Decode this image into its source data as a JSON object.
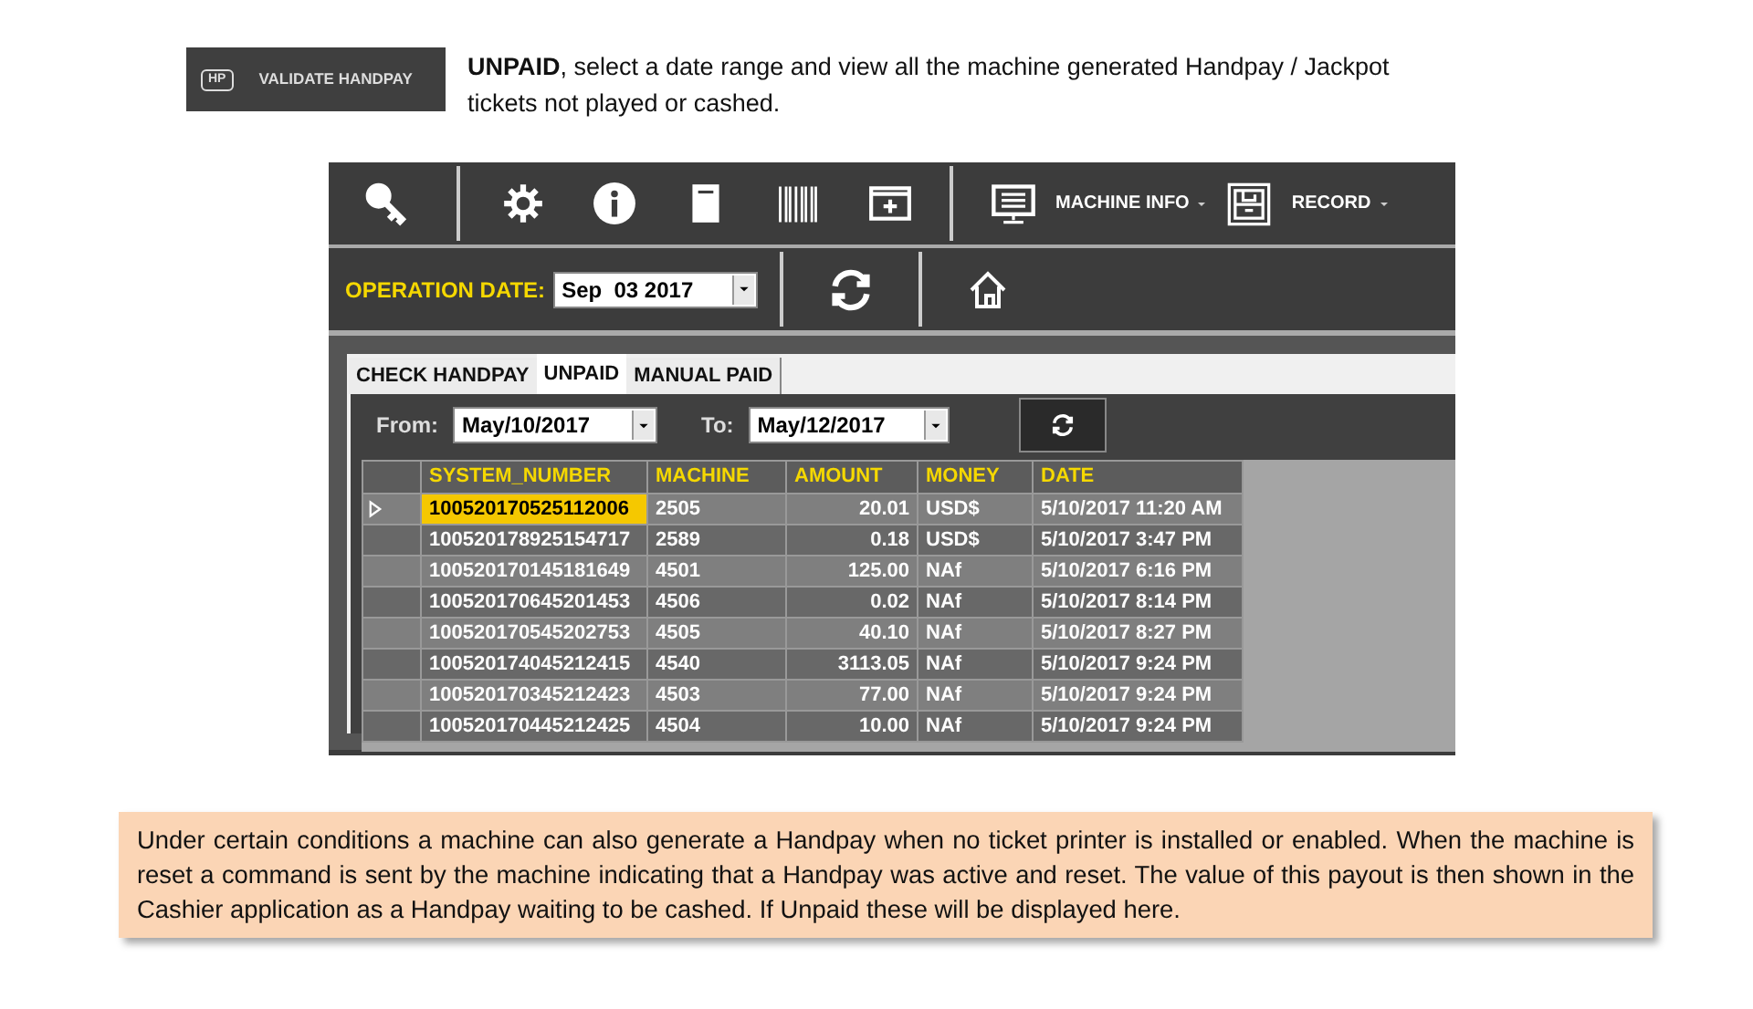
{
  "header": {
    "button_badge": "HP",
    "button_label": "VALIDATE HANDPAY",
    "description": "**UNPAID**, select a date range and view all the machine generated Handpay / Jackpot tickets not played or cashed."
  },
  "app": {
    "toolbar": {
      "menus": [
        {
          "label": "MACHINE INFO"
        },
        {
          "label": "RECORD"
        }
      ]
    },
    "operation_date": {
      "label": "OPERATION DATE:",
      "value": "Sep  03 2017"
    },
    "tabs": [
      {
        "label": "CHECK HANDPAY",
        "selected": false
      },
      {
        "label": "UNPAID",
        "selected": true
      },
      {
        "label": "MANUAL PAID",
        "selected": false
      }
    ],
    "filter": {
      "from_label": "From:",
      "from_value": "May/10/2017",
      "to_label": "To:",
      "to_value": "May/12/2017"
    },
    "table": {
      "columns": [
        "SYSTEM_NUMBER",
        "MACHINE",
        "AMOUNT",
        "MONEY",
        "DATE"
      ],
      "rows": [
        {
          "selected": true,
          "cells": [
            "100520170525112006",
            "2505",
            "20.01",
            "USD$",
            "5/10/2017 11:20 AM"
          ]
        },
        {
          "selected": false,
          "cells": [
            "100520178925154717",
            "2589",
            "0.18",
            "USD$",
            "5/10/2017 3:47 PM"
          ]
        },
        {
          "selected": false,
          "cells": [
            "100520170145181649",
            "4501",
            "125.00",
            "NAf",
            "5/10/2017 6:16 PM"
          ]
        },
        {
          "selected": false,
          "cells": [
            "100520170645201453",
            "4506",
            "0.02",
            "NAf",
            "5/10/2017 8:14 PM"
          ]
        },
        {
          "selected": false,
          "cells": [
            "100520170545202753",
            "4505",
            "40.10",
            "NAf",
            "5/10/2017 8:27 PM"
          ]
        },
        {
          "selected": false,
          "cells": [
            "100520174045212415",
            "4540",
            "3113.05",
            "NAf",
            "5/10/2017 9:24 PM"
          ]
        },
        {
          "selected": false,
          "cells": [
            "100520170345212423",
            "4503",
            "77.00",
            "NAf",
            "5/10/2017 9:24 PM"
          ]
        },
        {
          "selected": false,
          "cells": [
            "100520170445212425",
            "4504",
            "10.00",
            "NAf",
            "5/10/2017 9:24 PM"
          ]
        }
      ]
    }
  },
  "note": "Under certain conditions a machine can also generate a Handpay when no ticket printer is installed or enabled. When the machine is reset a command is sent by the machine indicating that a Handpay was active and reset. The value of this payout is then shown in the Cashier application as a Handpay waiting to be cashed. If Unpaid these will  be displayed here."
}
